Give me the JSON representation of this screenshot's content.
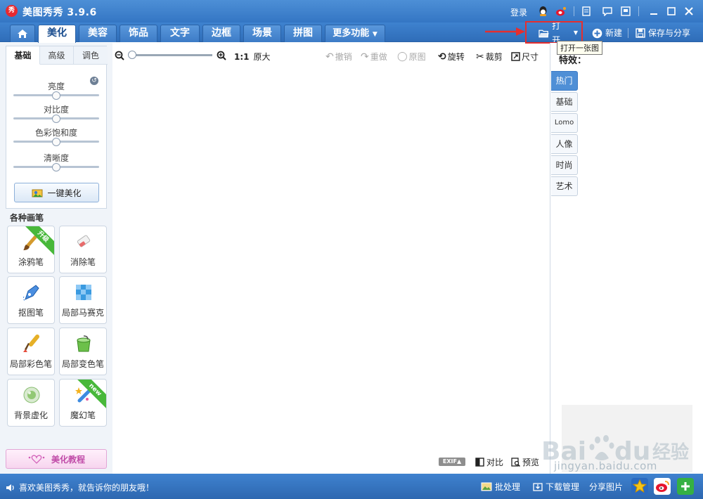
{
  "window": {
    "title": "美图秀秀 3.9.6",
    "logo_text": "秀",
    "login": "登录"
  },
  "nav": {
    "tabs": [
      "美化",
      "美容",
      "饰品",
      "文字",
      "边框",
      "场景",
      "拼图"
    ],
    "more": "更多功能",
    "open": "打开",
    "new": "新建",
    "save_share": "保存与分享",
    "tooltip": "打开一张图"
  },
  "left_panel": {
    "subtabs": [
      "基础",
      "高级",
      "调色"
    ],
    "sliders": [
      {
        "label": "亮度",
        "level": 0.5
      },
      {
        "label": "对比度",
        "level": 0.5
      },
      {
        "label": "色彩饱和度",
        "level": 0.5
      },
      {
        "label": "清晰度",
        "level": 0.5
      }
    ],
    "auto_beautify": "一键美化",
    "brush_heading": "各种画笔",
    "brushes": [
      {
        "label": "涂鸦笔",
        "icon": "brush-icon",
        "badge": "升级"
      },
      {
        "label": "消除笔",
        "icon": "eraser-icon",
        "badge": ""
      },
      {
        "label": "抠图笔",
        "icon": "pen-tool-icon",
        "badge": ""
      },
      {
        "label": "局部马赛克",
        "icon": "mosaic-icon",
        "badge": ""
      },
      {
        "label": "局部彩色笔",
        "icon": "color-brush-icon",
        "badge": ""
      },
      {
        "label": "局部变色笔",
        "icon": "paint-bucket-icon",
        "badge": ""
      },
      {
        "label": "背景虚化",
        "icon": "blur-icon",
        "badge": ""
      },
      {
        "label": "魔幻笔",
        "icon": "magic-wand-icon",
        "badge": "new"
      }
    ],
    "tutorial": "美化教程"
  },
  "toolbar": {
    "ratio": "1:1",
    "original_size": "原大",
    "undo": "撤销",
    "redo": "重做",
    "original": "原图",
    "rotate": "旋转",
    "crop": "裁剪",
    "resize": "尺寸"
  },
  "right_panel": {
    "effects_label": "特效：",
    "tabs": [
      "热门",
      "基础",
      "Lomo",
      "人像",
      "时尚",
      "艺术"
    ]
  },
  "canvas_footer": {
    "exif": "EXIF▲",
    "compare": "对比",
    "preview": "预览"
  },
  "statusbar": {
    "message": "喜欢美图秀秀，就告诉你的朋友哦！",
    "batch": "批处理",
    "download_manager": "下载管理",
    "share_photo": "分享图片"
  },
  "watermark": {
    "text": "jingyan.baidu.com"
  },
  "colors": {
    "title_blue": "#3476c4",
    "highlight_red": "#e62e2e",
    "effect_active": "#4f8fd6"
  }
}
